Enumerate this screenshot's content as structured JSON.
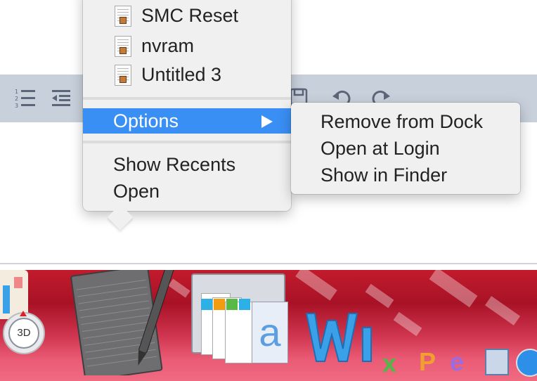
{
  "menu": {
    "recents": [
      {
        "label": "SMC Reset"
      },
      {
        "label": "nvram"
      },
      {
        "label": "Untitled 3"
      }
    ],
    "options_label": "Options",
    "options_arrow": "▶",
    "show_recents_label": "Show Recents",
    "open_label": "Open"
  },
  "submenu": {
    "items": [
      {
        "label": "Remove from Dock"
      },
      {
        "label": "Open at Login"
      },
      {
        "label": "Show in Finder"
      }
    ]
  },
  "toolbar": {
    "icons": [
      "numbered-list-icon",
      "outdent-icon",
      "save-icon",
      "undo-icon",
      "redo-icon"
    ]
  },
  "dock": {
    "compass_label": "3D",
    "apps": [
      "maps-app-icon",
      "textedit-app-icon",
      "iwork-apps-icon",
      "word-app-icon",
      "excel-app-icon",
      "powerpoint-app-icon",
      "edge-app-icon",
      "preview-app-icon",
      "safari-app-icon"
    ]
  },
  "colors": {
    "highlight": "#3a8ff5",
    "toolbar_bg": "#c8d0dc",
    "dock_bg": "#c21b2c"
  }
}
